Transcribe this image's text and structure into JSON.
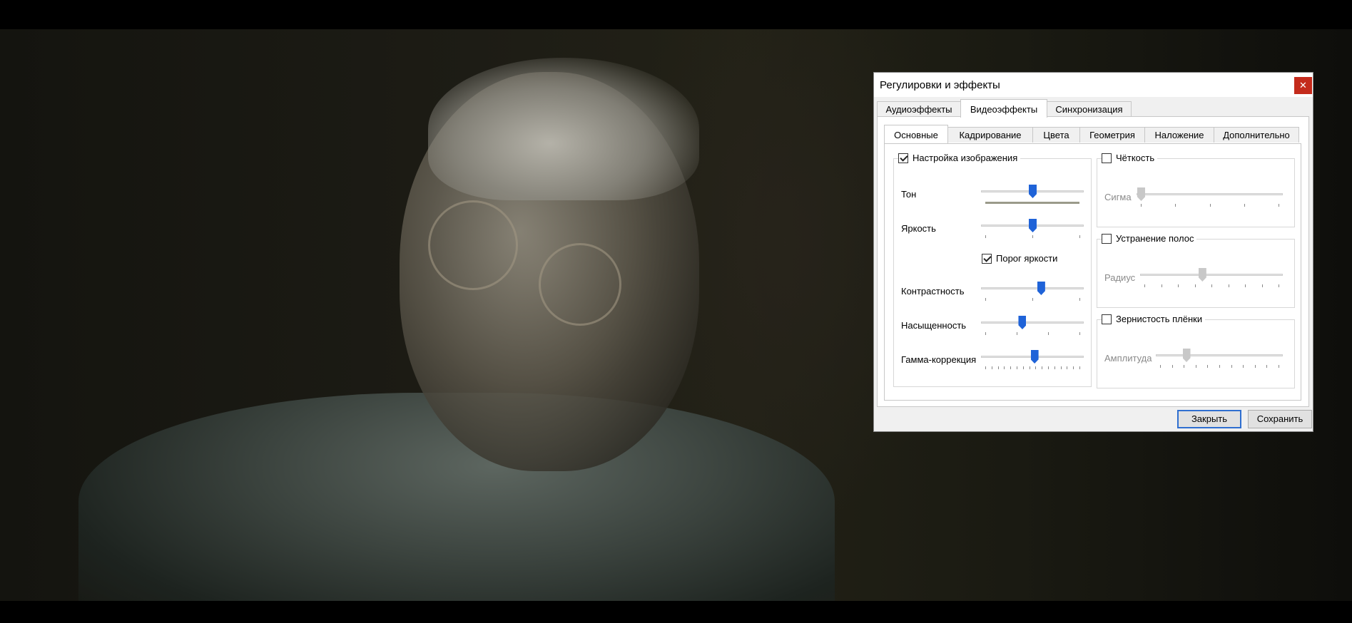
{
  "dialog": {
    "title": "Регулировки и эффекты",
    "close_glyph": "✕"
  },
  "tabs": [
    "Аудиоэффекты",
    "Видеоэффекты",
    "Синхронизация"
  ],
  "active_tab": "Видеоэффекты",
  "subtabs": [
    "Основные",
    "Кадрирование",
    "Цвета",
    "Геометрия",
    "Наложение",
    "Дополнительно"
  ],
  "active_subtab": "Основные",
  "image_adjust": {
    "title": "Настройка изображения",
    "checked": true,
    "sliders": [
      {
        "label": "Тон",
        "value": 0.5
      },
      {
        "label": "Яркость",
        "value": 0.5
      },
      {
        "label": "Контрастность",
        "value": 0.59
      },
      {
        "label": "Насыщенность",
        "value": 0.39
      },
      {
        "label": "Гамма-коррекция",
        "value": 0.52
      }
    ],
    "brightness_threshold": {
      "label": "Порог яркости",
      "checked": true
    }
  },
  "sharpness": {
    "title": "Чёткость",
    "checked": false,
    "slider": {
      "label": "Сигма",
      "value": 0.0
    }
  },
  "debanding": {
    "title": "Устранение полос",
    "checked": false,
    "slider": {
      "label": "Радиус",
      "value": 0.43
    }
  },
  "film_grain": {
    "title": "Зернистость плёнки",
    "checked": false,
    "slider": {
      "label": "Амплитуда",
      "value": 0.22
    }
  },
  "buttons": {
    "close": "Закрыть",
    "save": "Сохранить"
  },
  "colors": {
    "accent": "#1f63d8",
    "close_bg": "#c42b1c",
    "hue_bar": "#9a9a8a"
  }
}
